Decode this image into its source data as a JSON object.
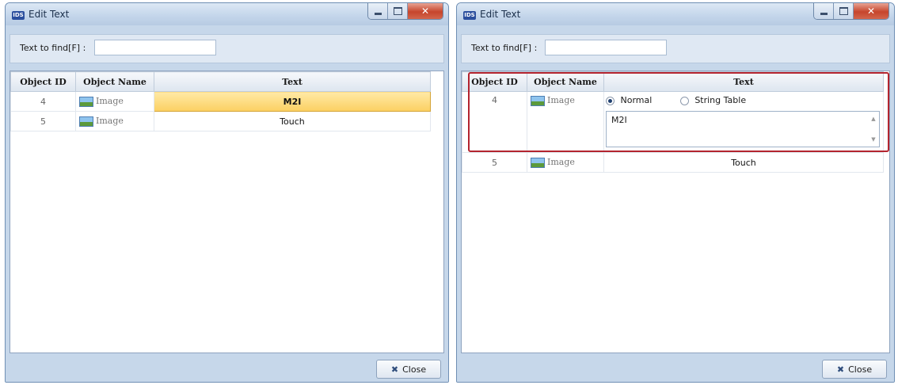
{
  "windows": [
    {
      "title": "Edit Text",
      "app_icon_text": "IDS",
      "find_label": "Text to find[F] :",
      "find_value": "",
      "columns": [
        "Object ID",
        "Object Name",
        "Text"
      ],
      "rows": [
        {
          "id": "4",
          "name": "Image",
          "text": "M2I",
          "selected": true
        },
        {
          "id": "5",
          "name": "Image",
          "text": "Touch",
          "selected": false
        }
      ],
      "close_label": "Close"
    },
    {
      "title": "Edit Text",
      "app_icon_text": "IDS",
      "find_label": "Text to find[F] :",
      "find_value": "",
      "columns": [
        "Object ID",
        "Object Name",
        "Text"
      ],
      "rows": [
        {
          "id": "4",
          "name": "Image",
          "text": "M2I",
          "editing": true
        },
        {
          "id": "5",
          "name": "Image",
          "text": "Touch"
        }
      ],
      "editor": {
        "radio_normal": "Normal",
        "radio_string_table": "String Table",
        "selected_radio": "Normal",
        "memo_value": "M2I"
      },
      "close_label": "Close"
    }
  ],
  "colors": {
    "highlight_border": "#b3242f",
    "selected_cell": "#fbd062",
    "window_frame": "#c6d7ea"
  },
  "icons": [
    "minimize-icon",
    "maximize-icon",
    "close-icon",
    "image-icon",
    "close-x-icon",
    "app-icon"
  ]
}
